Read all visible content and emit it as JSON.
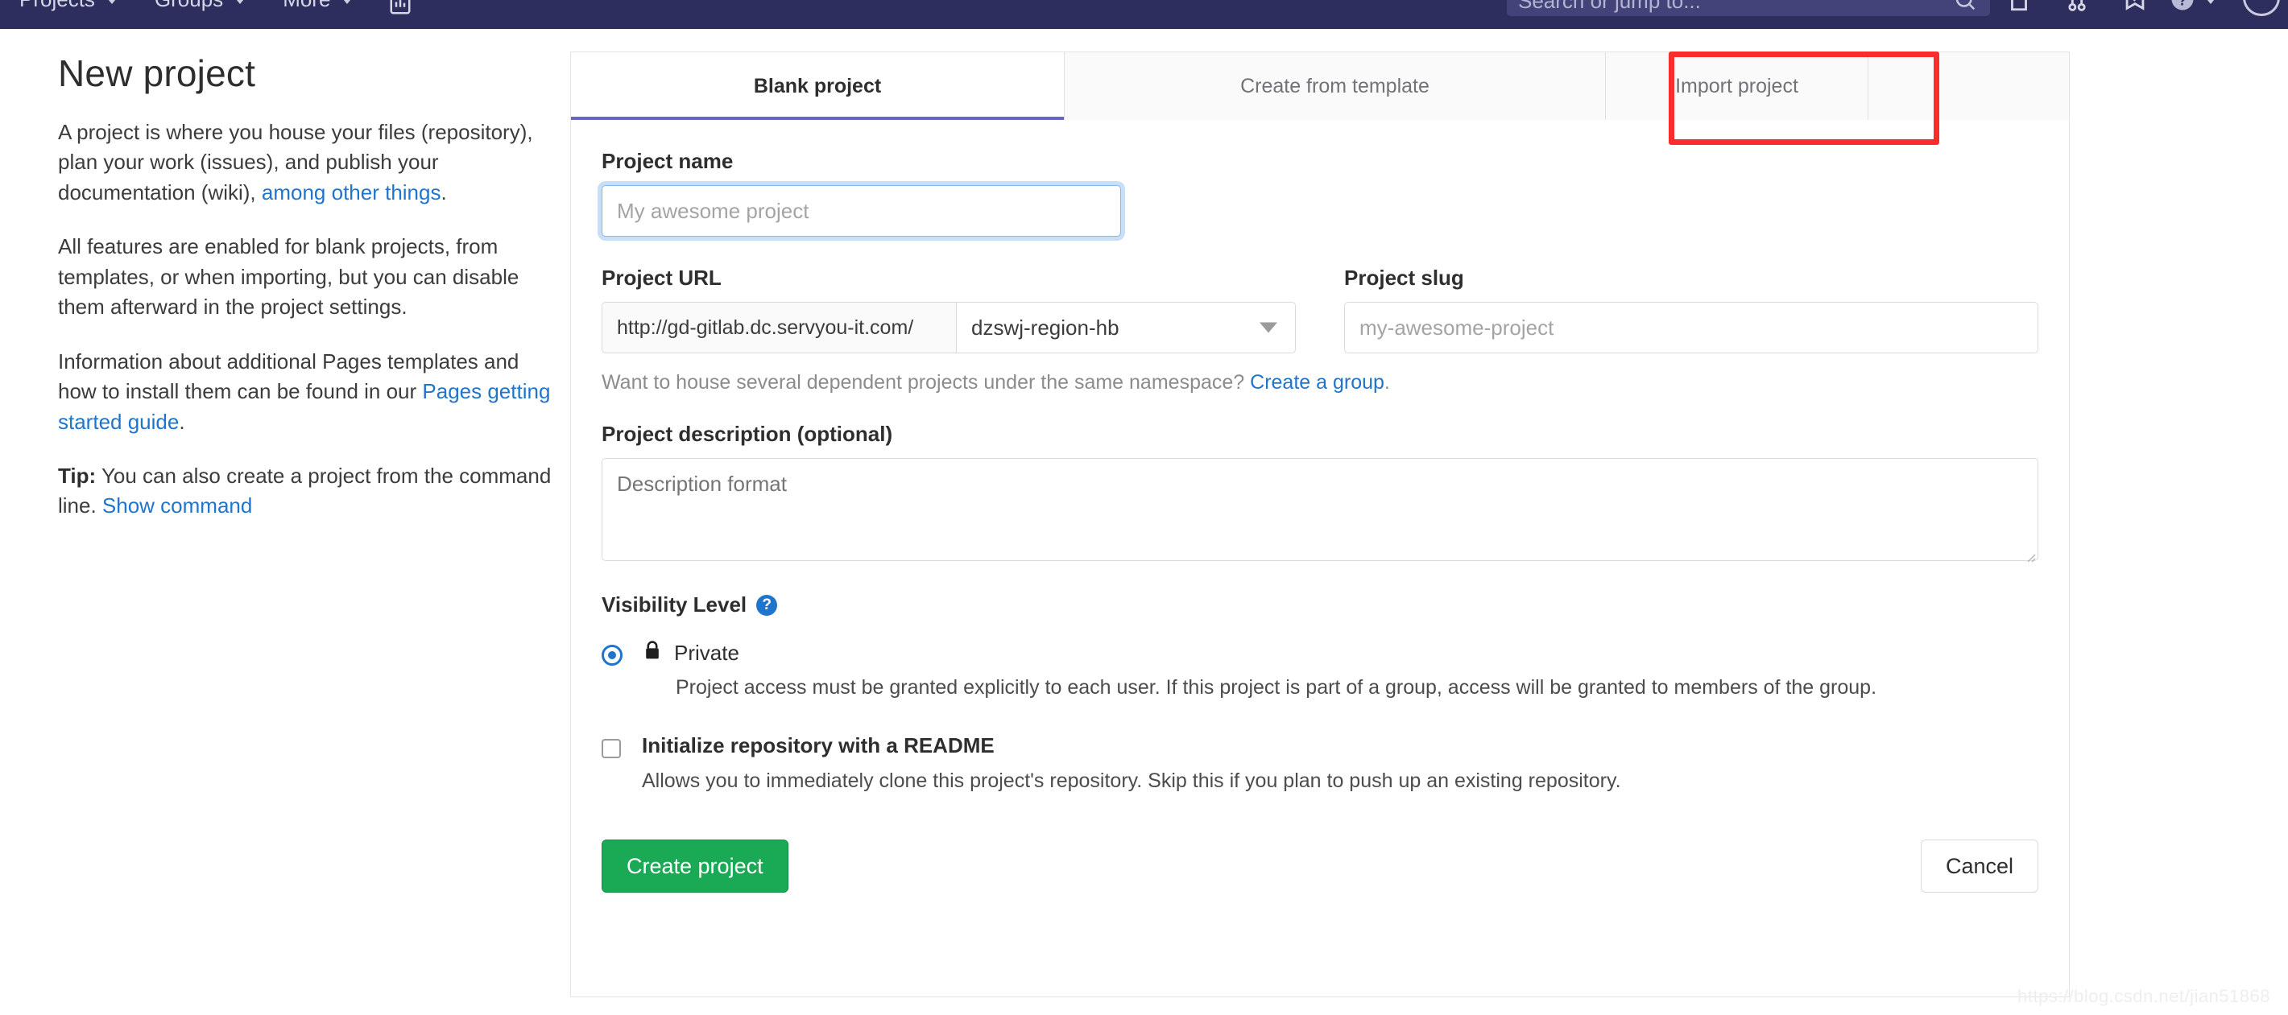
{
  "navbar": {
    "left_items": [
      {
        "label": "Projects",
        "caret": true
      },
      {
        "label": "Groups",
        "caret": true
      },
      {
        "label": "More",
        "caret": true
      }
    ],
    "chart_icon": "analytics-icon",
    "search": {
      "placeholder": "Search or jump to...",
      "icon": "search-icon"
    },
    "right_icons": [
      "issues-icon",
      "merge-requests-icon",
      "todos-icon",
      "help-icon"
    ],
    "avatar": "user-avatar",
    "background_color": "#2e2e5e"
  },
  "sidebar": {
    "title": "New project",
    "paragraphs": [
      {
        "id": "p1",
        "pre": "A project is where you house your files (repository), plan your work (issues), and publish your documentation (wiki), ",
        "link": "among other things",
        "post": "."
      },
      {
        "id": "p2",
        "pre": "All features are enabled for blank projects, from templates, or when importing, but you can disable them afterward in the project settings.",
        "link": "",
        "post": ""
      },
      {
        "id": "p3",
        "pre": "Information about additional Pages templates and how to install them can be found in our ",
        "link": "Pages getting started guide",
        "post": "."
      }
    ],
    "tip": {
      "label": "Tip:",
      "text": " You can also create a project from the command line. ",
      "link": "Show command"
    }
  },
  "tabs": [
    {
      "label": "Blank project",
      "active": true
    },
    {
      "label": "Create from template",
      "active": false
    },
    {
      "label": "Import project",
      "active": false,
      "highlighted": true
    }
  ],
  "form": {
    "project_name": {
      "label": "Project name",
      "placeholder": "My awesome project",
      "value": ""
    },
    "project_url": {
      "label": "Project URL",
      "prefix": "http://gd-gitlab.dc.servyou-it.com/",
      "namespace_selected": "dzswj-region-hb",
      "chevron": "chevron-down-icon"
    },
    "project_slug": {
      "label": "Project slug",
      "placeholder": "my-awesome-project",
      "value": ""
    },
    "namespace_hint": {
      "text": "Want to house several dependent projects under the same namespace? ",
      "link": "Create a group",
      "post": "."
    },
    "description": {
      "label": "Project description (optional)",
      "placeholder": "Description format",
      "value": ""
    },
    "visibility": {
      "label": "Visibility Level",
      "help_icon": "?",
      "options": [
        {
          "name": "Private",
          "icon": "lock-icon",
          "selected": true,
          "description": "Project access must be granted explicitly to each user. If this project is part of a group, access will be granted to members of the group."
        }
      ]
    },
    "readme": {
      "label": "Initialize repository with a README",
      "checked": false,
      "description": "Allows you to immediately clone this project's repository. Skip this if you plan to push up an existing repository."
    },
    "buttons": {
      "submit": "Create project",
      "cancel": "Cancel"
    }
  },
  "watermark": "https://blog.csdn.net/jian51868",
  "colors": {
    "navbar": "#2e2e5e",
    "link": "#1f75cb",
    "primary_button": "#1aaa55",
    "active_tab_underline": "#6666c4",
    "highlight_box": "#fb2c2c"
  }
}
